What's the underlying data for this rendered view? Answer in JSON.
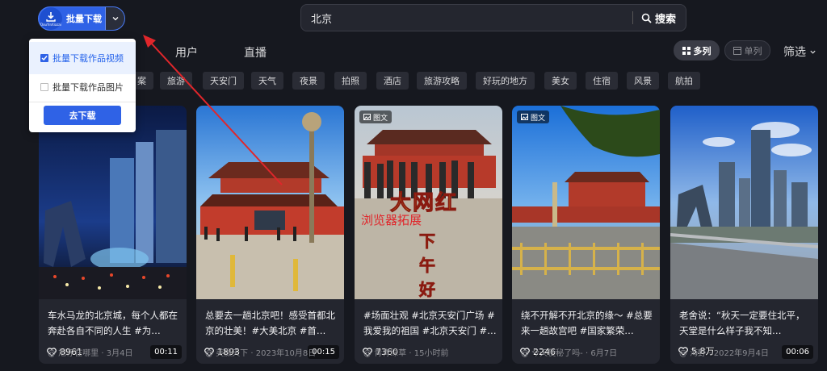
{
  "extension": {
    "label": "批量下载",
    "logo_text": "DouYinXiazai"
  },
  "search": {
    "value": "北京",
    "button_label": "搜索"
  },
  "dropdown": {
    "items": [
      {
        "label": "批量下载作品视频",
        "checked": true
      },
      {
        "label": "批量下载作品图片",
        "checked": false
      }
    ],
    "go_label": "去下载"
  },
  "tabs": [
    "用户",
    "直播"
  ],
  "view": {
    "multi_label": "多列",
    "single_label": "单列"
  },
  "filter_label": "筛选",
  "chips": [
    "案",
    "旅游",
    "天安门",
    "天气",
    "夜景",
    "拍照",
    "酒店",
    "旅游攻略",
    "好玩的地方",
    "美女",
    "住宿",
    "风景",
    "航拍"
  ],
  "cards": [
    {
      "likes": "8961",
      "duration": "00:11",
      "badge": "",
      "title": "车水马龙的北京城，每个人都在奔赴各自不同的人生 #为…",
      "author": "旭仔在哪里",
      "date": "3月4日"
    },
    {
      "likes": "1893",
      "duration": "00:15",
      "badge": "",
      "title": "总要去一趟北京吧！感受首都北京的壮美！#大美北京 #首…",
      "author": "美摄天下",
      "date": "2023年10月8日"
    },
    {
      "likes": "7360",
      "duration": "",
      "badge": "图文",
      "title": "#场面壮观 #北京天安门广场 #我爱我的祖国 #北京天安门 #…",
      "author": "青青绿草",
      "date": "15小时前",
      "overlay": [
        "大网红",
        "浏览器拓展",
        "下",
        "午",
        "好"
      ]
    },
    {
      "likes": "2246",
      "duration": "",
      "badge": "图文",
      "title": "绕不开解不开北京的缘～ #总要来一趟故宫吧 #国家繁荣…",
      "author": "今天使秘了吗-",
      "date": "6月7日"
    },
    {
      "likes": "5.8万",
      "duration": "00:06",
      "badge": "",
      "title": "老舍说：“秋天一定要住北平，天堂是什么样子我不知…",
      "author": "海野",
      "date": "2022年9月4日"
    }
  ],
  "colors": {
    "accent": "#2f62e6",
    "annotation_arrow": "#e0262b",
    "overlay_red": "#e0262b",
    "overlay_yellow": "#f3d22b"
  }
}
